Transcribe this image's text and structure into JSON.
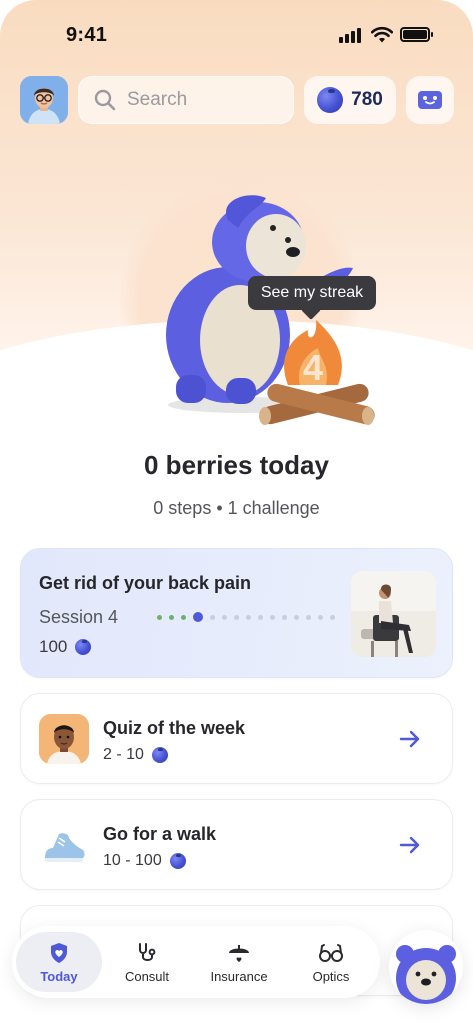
{
  "status_bar": {
    "time": "9:41"
  },
  "header": {
    "search_placeholder": "Search",
    "berries_count": "780"
  },
  "hero": {
    "tooltip": "See my streak",
    "streak_number": "4",
    "headline": "0 berries today",
    "subline": "0 steps • 1 challenge"
  },
  "challenge": {
    "title": "Get rid of your back pain",
    "session": "Session 4",
    "reward": "100",
    "progress": {
      "completed": 3,
      "current": 4,
      "total": 15
    }
  },
  "quiz": {
    "title": "Quiz of the week",
    "reward": "2 - 10"
  },
  "walk": {
    "title": "Go for a walk",
    "reward": "10 - 100"
  },
  "nav": {
    "today": "Today",
    "consult": "Consult",
    "insurance": "Insurance",
    "optics": "Optics"
  },
  "colors": {
    "accent": "#4e58d8",
    "header_gradient_top": "#f9dcc0",
    "challenge_card": "#e4eafc",
    "tooltip_bg": "#3a3a3f"
  },
  "icons": {
    "search": "search-icon",
    "berry": "blueberry-icon",
    "card": "member-card-icon",
    "arrow": "arrow-right-icon",
    "today": "heart-shield-icon",
    "consult": "stethoscope-icon",
    "insurance": "umbrella-icon",
    "optics": "glasses-icon"
  }
}
